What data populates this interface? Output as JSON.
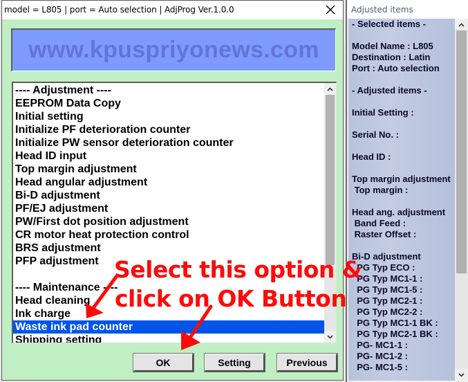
{
  "dialog": {
    "title": "model = L805 | port = Auto selection | AdjProg Ver.1.0.0",
    "close_icon": "close-icon",
    "banner_text": "www.kpuspriyonews.com",
    "list": {
      "items": [
        {
          "label": "---- Adjustment ----",
          "type": "header"
        },
        {
          "label": "EEPROM Data Copy",
          "type": "item"
        },
        {
          "label": "Initial setting",
          "type": "item"
        },
        {
          "label": "Initialize PF deterioration counter",
          "type": "item"
        },
        {
          "label": "Initialize PW sensor deterioration counter",
          "type": "item"
        },
        {
          "label": "Head ID input",
          "type": "item"
        },
        {
          "label": "Top margin adjustment",
          "type": "item"
        },
        {
          "label": "Head angular adjustment",
          "type": "item"
        },
        {
          "label": "Bi-D adjustment",
          "type": "item"
        },
        {
          "label": "PF/EJ adjustment",
          "type": "item"
        },
        {
          "label": "PW/First dot position adjustment",
          "type": "item"
        },
        {
          "label": "CR motor heat protection control",
          "type": "item"
        },
        {
          "label": "BRS adjustment",
          "type": "item"
        },
        {
          "label": "PFP adjustment",
          "type": "item"
        },
        {
          "label": "",
          "type": "blank"
        },
        {
          "label": "---- Maintenance ----",
          "type": "header"
        },
        {
          "label": "Head cleaning",
          "type": "item"
        },
        {
          "label": "Ink charge",
          "type": "item"
        },
        {
          "label": "Waste ink pad counter",
          "type": "item",
          "selected": true
        },
        {
          "label": "Shipping setting",
          "type": "item"
        }
      ],
      "selected_label": "Waste ink pad counter",
      "scroll_position_fraction": 0.0,
      "visible_fraction": 0.72
    },
    "buttons": {
      "ok": "OK",
      "setting": "Setting",
      "previous": "Previous"
    }
  },
  "annotation": {
    "line1": "Select this option &",
    "line2": "click on OK Button",
    "color": "#ff0a0a"
  },
  "side_window": {
    "title": "Adjusted items",
    "lines": [
      "- Selected items -",
      "",
      "Model Name : L805",
      "Destination : Latin",
      "Port : Auto selection",
      "",
      "- Adjusted items -",
      "",
      "Initial Setting :",
      "",
      "Serial No. :",
      "",
      "Head ID :",
      "",
      "Top margin adjustment",
      " Top margin :",
      "",
      "Head ang. adjustment",
      " Band Feed :",
      " Raster Offset :",
      "",
      "Bi-D adjustment",
      "  PG Typ ECO :",
      "  PG Typ MC1-1 :",
      "  PG Typ MC1-5 :",
      "  PG Typ MC2-1 :",
      "  PG Typ MC2-2 :",
      "  PG Typ MC1-1 BK :",
      "  PG Typ MC2-1 BK :",
      "  PG- MC1-1 :",
      "  PG- MC1-2 :",
      "  PG- MC1-5 :"
    ]
  },
  "colors": {
    "dialog_bg": "#c0efc3",
    "banner_bg": "#7f9aff",
    "banner_text": "#6275d6",
    "selection": "#0055e8",
    "side_bg": "#bfc8df"
  }
}
